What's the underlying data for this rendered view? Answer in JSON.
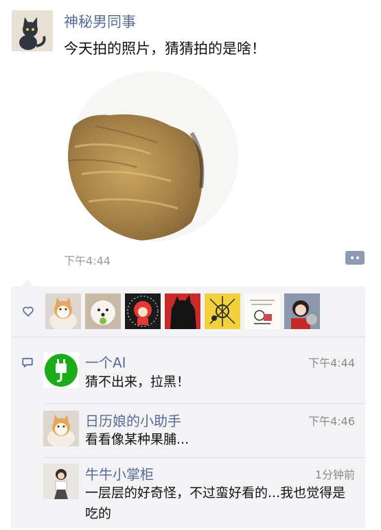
{
  "post": {
    "author": "神秘男同事",
    "text": "今天拍的照片，猜猜拍的是啥！",
    "time": "下午4:44",
    "avatar_icon": "black-cat-avatar",
    "photo_icon": "food-closeup-photo",
    "more_icon": "more-dots-icon"
  },
  "likes": {
    "heart_icon": "heart-outline-icon",
    "avatars": [
      "cat-avatar",
      "samoyed-avatar",
      "red-character-avatar",
      "black-monster-avatar",
      "yellow-art-avatar",
      "sketch-avatar",
      "girl-with-cat-avatar"
    ]
  },
  "comments": [
    {
      "name": "一个AI",
      "time": "下午4:44",
      "text": "猜不出来，拉黑！",
      "avatar": "green-plug-avatar"
    },
    {
      "name": "日历娘的小助手",
      "time": "下午4:46",
      "text": "看看像某种果脯...",
      "avatar": "cat-avatar"
    },
    {
      "name": "牛牛小掌柜",
      "time": "1分钟前",
      "text": "一层层的好奇怪，不过蛮好看的...我也觉得是吃的",
      "avatar": "girl-photo-avatar"
    }
  ],
  "colors": {
    "link": "#576b95",
    "panel": "#f3f3f5",
    "wechat_green": "#1aad19"
  }
}
